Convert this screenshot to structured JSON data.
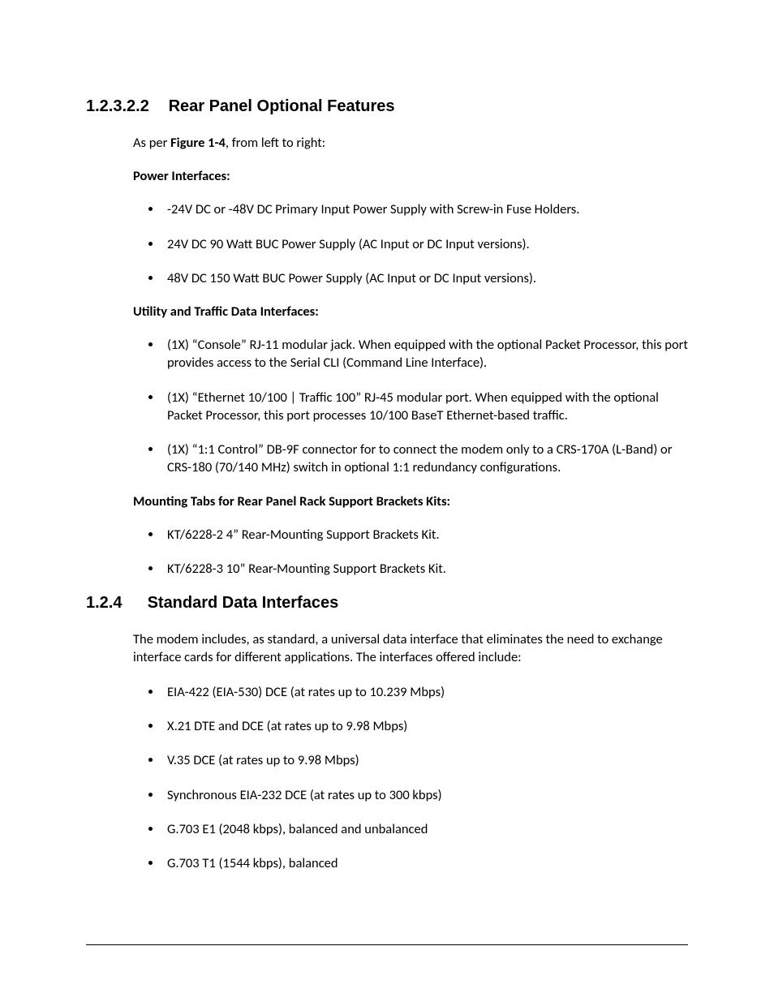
{
  "section1": {
    "number": "1.2.3.2.2",
    "title": "Rear Panel Optional Features",
    "intro_prefix": "As per ",
    "intro_bold": "Figure 1-4",
    "intro_suffix": ", from left to right:",
    "groups": [
      {
        "heading": "Power Interfaces:",
        "items": [
          "-24V DC or -48V DC Primary Input Power Supply with Screw-in Fuse Holders.",
          "24V DC 90 Watt BUC Power Supply (AC Input or DC Input versions).",
          "48V DC 150 Watt BUC Power Supply (AC Input or DC Input versions)."
        ]
      },
      {
        "heading": "Utility and Traffic Data Interfaces:",
        "items": [
          "(1X) “Console” RJ-11 modular jack. When equipped with the optional Packet Processor, this port provides access to the Serial CLI (Command Line Interface).",
          "(1X) “Ethernet 10/100 | Traffic 100” RJ-45 modular port. When equipped with the optional Packet Processor, this port processes 10/100 BaseT Ethernet-based traffic.",
          "(1X) “1:1 Control”  DB-9F connector for to connect the modem only to a CRS-170A (L-Band) or CRS-180 (70/140 MHz) switch in optional 1:1 redundancy configurations."
        ]
      },
      {
        "heading": "Mounting Tabs for Rear Panel Rack Support Brackets Kits:",
        "items": [
          "KT/6228-2 4” Rear-Mounting Support Brackets Kit.",
          "KT/6228-3 10” Rear-Mounting Support Brackets Kit."
        ]
      }
    ]
  },
  "section2": {
    "number": "1.2.4",
    "title": "Standard Data Interfaces",
    "intro": "The modem includes, as standard, a universal data interface that eliminates the need to exchange interface cards for different applications. The interfaces offered include:",
    "items": [
      "EIA-422 (EIA-530) DCE (at rates up to 10.239 Mbps)",
      "X.21 DTE and DCE (at rates up to 9.98 Mbps)",
      "V.35 DCE (at rates up to 9.98 Mbps)",
      "Synchronous EIA-232 DCE (at rates up to 300 kbps)",
      "G.703 E1 (2048 kbps), balanced and unbalanced",
      "G.703 T1 (1544 kbps), balanced"
    ]
  }
}
